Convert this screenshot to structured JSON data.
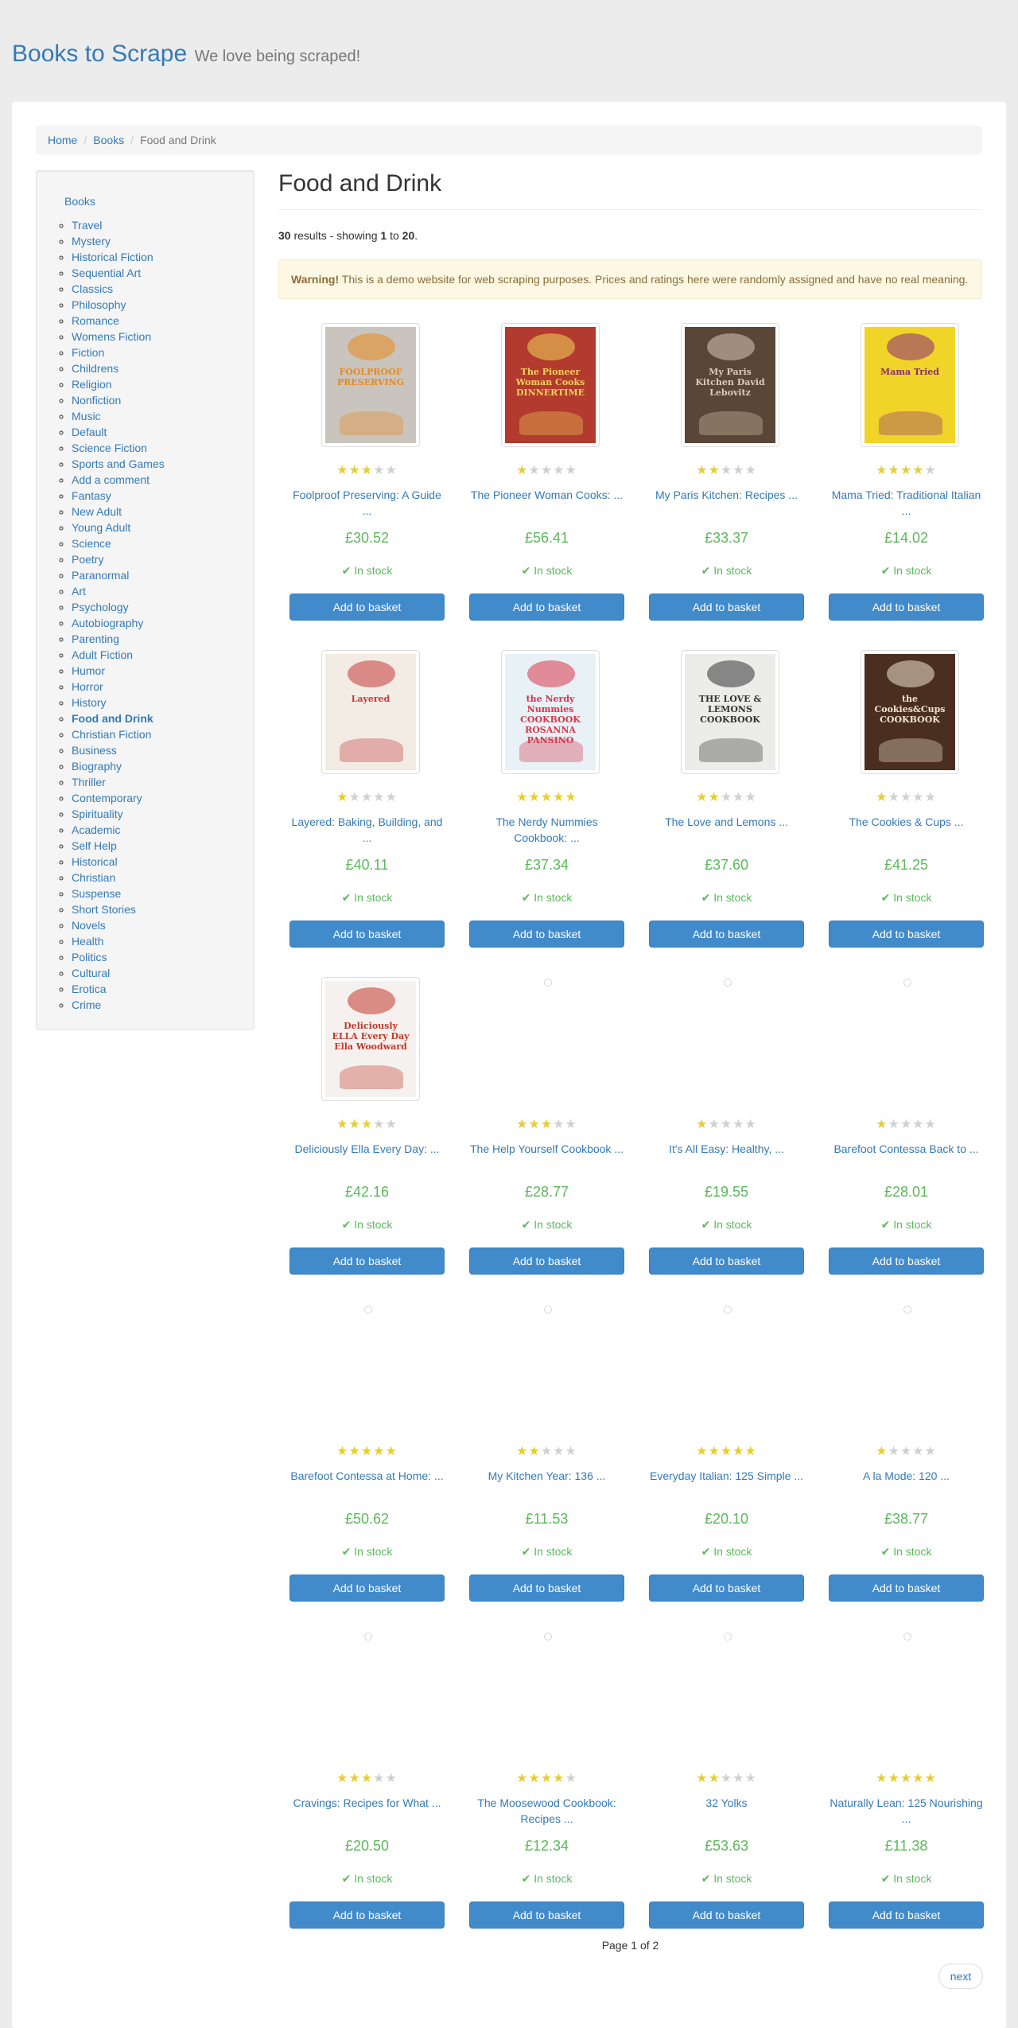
{
  "header": {
    "brand_title": "Books to Scrape",
    "brand_tagline": "We love being scraped!"
  },
  "breadcrumb": {
    "home": "Home",
    "books": "Books",
    "current": "Food and Drink",
    "separator": "/"
  },
  "sidebar": {
    "top_label": "Books",
    "current": "Food and Drink",
    "categories": [
      "Travel",
      "Mystery",
      "Historical Fiction",
      "Sequential Art",
      "Classics",
      "Philosophy",
      "Romance",
      "Womens Fiction",
      "Fiction",
      "Childrens",
      "Religion",
      "Nonfiction",
      "Music",
      "Default",
      "Science Fiction",
      "Sports and Games",
      "Add a comment",
      "Fantasy",
      "New Adult",
      "Young Adult",
      "Science",
      "Poetry",
      "Paranormal",
      "Art",
      "Psychology",
      "Autobiography",
      "Parenting",
      "Adult Fiction",
      "Humor",
      "Horror",
      "History",
      "Food and Drink",
      "Christian Fiction",
      "Business",
      "Biography",
      "Thriller",
      "Contemporary",
      "Spirituality",
      "Academic",
      "Self Help",
      "Historical",
      "Christian",
      "Suspense",
      "Short Stories",
      "Novels",
      "Health",
      "Politics",
      "Cultural",
      "Erotica",
      "Crime"
    ]
  },
  "main": {
    "heading": "Food and Drink",
    "results_total": "30",
    "results_text_1": " results - showing ",
    "results_from": "1",
    "results_text_2": " to ",
    "results_to": "20",
    "results_text_3": ".",
    "warning_label": "Warning!",
    "warning_text": " This is a demo website for web scraping purposes. Prices and ratings here were randomly assigned and have no real meaning."
  },
  "product_common": {
    "stock_icon": "check-icon",
    "stock_text": "In stock",
    "basket_label": "Add to basket",
    "star_on_color": "#E6CE31",
    "price_color": "#5cb85c"
  },
  "products": [
    {
      "title": "Foolproof Preserving: A Guide ...",
      "price": "£30.52",
      "rating": 3,
      "cover": "preserving"
    },
    {
      "title": "The Pioneer Woman Cooks: ...",
      "price": "£56.41",
      "rating": 1,
      "cover": "pioneer"
    },
    {
      "title": "My Paris Kitchen: Recipes ...",
      "price": "£33.37",
      "rating": 2,
      "cover": "paris"
    },
    {
      "title": "Mama Tried: Traditional Italian ...",
      "price": "£14.02",
      "rating": 4,
      "cover": "mama"
    },
    {
      "title": "Layered: Baking, Building, and ...",
      "price": "£40.11",
      "rating": 1,
      "cover": "layered"
    },
    {
      "title": "The Nerdy Nummies Cookbook: ...",
      "price": "£37.34",
      "rating": 5,
      "cover": "nerdy"
    },
    {
      "title": "The Love and Lemons ...",
      "price": "£37.60",
      "rating": 2,
      "cover": "lemons"
    },
    {
      "title": "The Cookies & Cups ...",
      "price": "£41.25",
      "rating": 1,
      "cover": "cookies"
    },
    {
      "title": "Deliciously Ella Every Day: ...",
      "price": "£42.16",
      "rating": 3,
      "cover": "ella"
    },
    {
      "title": "The Help Yourself Cookbook ...",
      "price": "£28.77",
      "rating": 3,
      "cover": ""
    },
    {
      "title": "It's All Easy: Healthy, ...",
      "price": "£19.55",
      "rating": 1,
      "cover": ""
    },
    {
      "title": "Barefoot Contessa Back to ...",
      "price": "£28.01",
      "rating": 1,
      "cover": ""
    },
    {
      "title": "Barefoot Contessa at Home: ...",
      "price": "£50.62",
      "rating": 5,
      "cover": ""
    },
    {
      "title": "My Kitchen Year: 136 ...",
      "price": "£11.53",
      "rating": 2,
      "cover": ""
    },
    {
      "title": "Everyday Italian: 125 Simple ...",
      "price": "£20.10",
      "rating": 5,
      "cover": ""
    },
    {
      "title": "A la Mode: 120 ...",
      "price": "£38.77",
      "rating": 1,
      "cover": ""
    },
    {
      "title": "Cravings: Recipes for What ...",
      "price": "£20.50",
      "rating": 3,
      "cover": ""
    },
    {
      "title": "The Moosewood Cookbook: Recipes ...",
      "price": "£12.34",
      "rating": 4,
      "cover": ""
    },
    {
      "title": "32 Yolks",
      "price": "£53.63",
      "rating": 2,
      "cover": ""
    },
    {
      "title": "Naturally Lean: 125 Nourishing ...",
      "price": "£11.38",
      "rating": 5,
      "cover": ""
    }
  ],
  "covers": {
    "preserving": {
      "text": "FOOLPROOF PRESERVING",
      "bg": "#c9c4bd",
      "accent": "#e88a1e"
    },
    "pioneer": {
      "text": "The Pioneer Woman Cooks DINNERTIME",
      "bg": "#b23a2e",
      "accent": "#f2d35a"
    },
    "paris": {
      "text": "My Paris Kitchen David Lebovitz",
      "bg": "#5a4636",
      "accent": "#d9cbb8"
    },
    "mama": {
      "text": "Mama Tried",
      "bg": "#f0d428",
      "accent": "#8a2c7a"
    },
    "layered": {
      "text": "Layered",
      "bg": "#f3ece4",
      "accent": "#c23a3a"
    },
    "nerdy": {
      "text": "the Nerdy Nummies COOKBOOK ROSANNA PANSINO",
      "bg": "#e8f1f6",
      "accent": "#d8364b"
    },
    "lemons": {
      "text": "THE LOVE & LEMONS COOKBOOK",
      "bg": "#ececea",
      "accent": "#333333"
    },
    "cookies": {
      "text": "the Cookies&Cups COOKBOOK",
      "bg": "#4a2e1f",
      "accent": "#f2e6d0"
    },
    "ella": {
      "text": "Deliciously ELLA Every Day Ella Woodward",
      "bg": "#f5f1ee",
      "accent": "#c0392b"
    }
  },
  "pager": {
    "current": "Page 1 of 2",
    "next": "next"
  }
}
